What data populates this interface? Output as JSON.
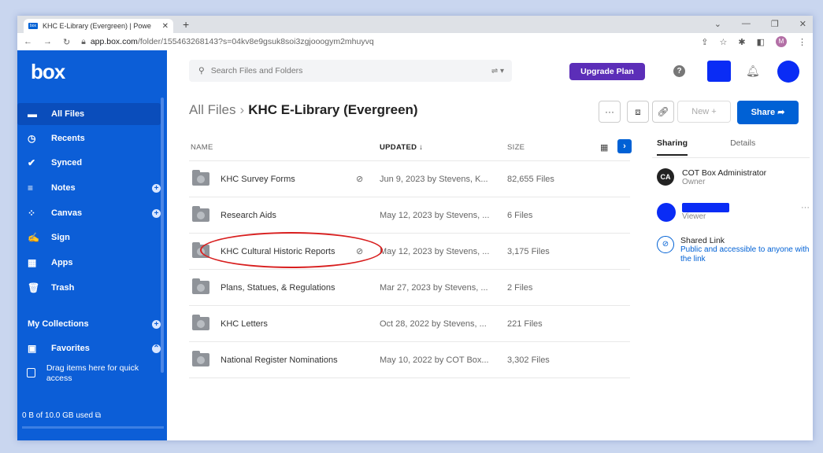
{
  "browser": {
    "tab_title": "KHC E-Library (Evergreen) | Powe",
    "favicon_text": "box",
    "url_host": "app.box.com",
    "url_path": "/folder/155463268143?s=04kv8e9gsuk8soi3zgjooogym2mhuyvq",
    "profile_initial": "M"
  },
  "sidebar": {
    "logo": "box",
    "items": [
      {
        "label": "All Files",
        "icon": "folder-icon"
      },
      {
        "label": "Recents",
        "icon": "clock-icon"
      },
      {
        "label": "Synced",
        "icon": "check-circle-icon"
      },
      {
        "label": "Notes",
        "icon": "notes-icon"
      },
      {
        "label": "Canvas",
        "icon": "canvas-icon"
      },
      {
        "label": "Sign",
        "icon": "sign-icon"
      },
      {
        "label": "Apps",
        "icon": "apps-grid-icon"
      },
      {
        "label": "Trash",
        "icon": "trash-icon"
      }
    ],
    "collections_label": "My Collections",
    "favorites_label": "Favorites",
    "quick_access": "Drag items here for quick access",
    "storage": "0 B of 10.0 GB used"
  },
  "header": {
    "search_placeholder": "Search Files and Folders",
    "upgrade_label": "Upgrade Plan"
  },
  "breadcrumb": {
    "root": "All Files",
    "current": "KHC E-Library (Evergreen)"
  },
  "toolbar": {
    "more": "···",
    "new_label": "New +",
    "share_label": "Share"
  },
  "columns": {
    "name": "NAME",
    "updated": "UPDATED ↓",
    "size": "SIZE"
  },
  "rows": [
    {
      "name": "KHC Survey Forms",
      "shared": true,
      "updated": "Jun 9, 2023 by Stevens, K...",
      "size": "82,655 Files"
    },
    {
      "name": "Research Aids",
      "shared": false,
      "updated": "May 12, 2023 by Stevens, ...",
      "size": "6 Files"
    },
    {
      "name": "KHC Cultural Historic Reports",
      "shared": true,
      "updated": "May 12, 2023 by Stevens, ...",
      "size": "3,175 Files"
    },
    {
      "name": "Plans, Statues, & Regulations",
      "shared": false,
      "updated": "Mar 27, 2023 by Stevens, ...",
      "size": "2 Files"
    },
    {
      "name": "KHC Letters",
      "shared": false,
      "updated": "Oct 28, 2022 by Stevens, ...",
      "size": "221 Files"
    },
    {
      "name": "National Register Nominations",
      "shared": false,
      "updated": "May 10, 2022 by COT Box...",
      "size": "3,302 Files"
    }
  ],
  "panel": {
    "tab_sharing": "Sharing",
    "tab_details": "Details",
    "owner_initials": "CA",
    "owner_name": "COT Box Administrator",
    "owner_role": "Owner",
    "viewer_role": "Viewer",
    "shared_link_title": "Shared Link",
    "shared_link_desc": "Public and accessible to anyone with the link"
  },
  "colors": {
    "sidebar": "#0c5ed7",
    "upgrade": "#5c2eb8",
    "share": "#0061d5",
    "annotation": "#d81e1e",
    "redaction": "#0a2cf5"
  }
}
